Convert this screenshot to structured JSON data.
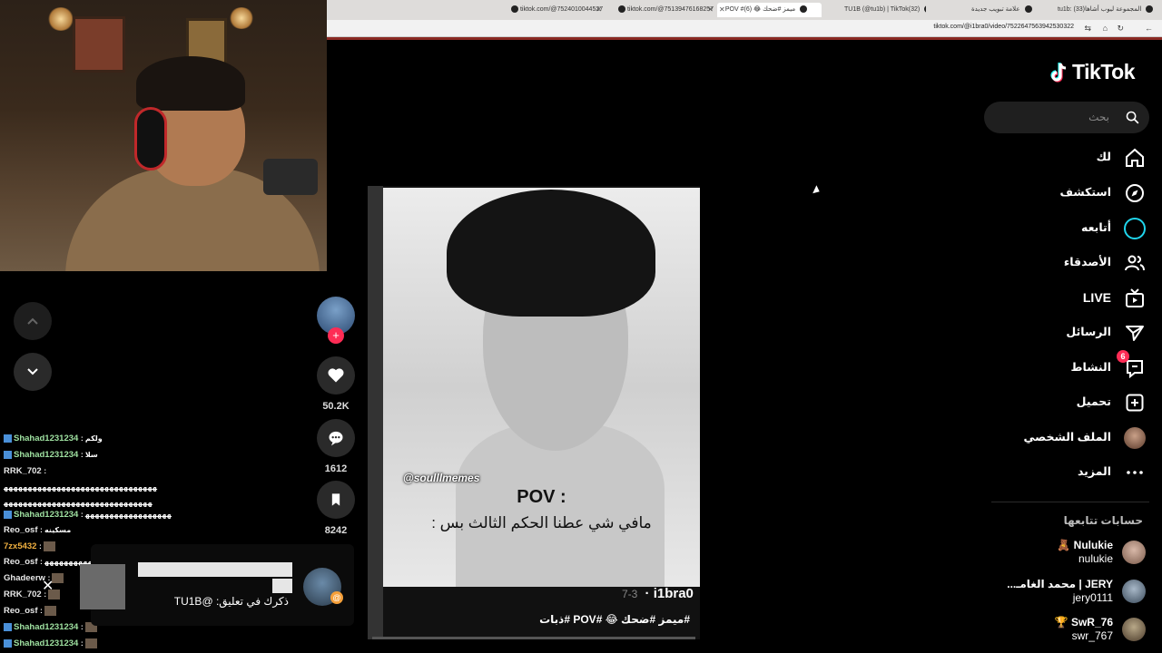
{
  "browser": {
    "tabs": [
      {
        "title": "tiktok.com/@7524010044527",
        "active": false
      },
      {
        "title": "tiktok.com/@75139476168257",
        "active": false
      },
      {
        "title": "POV #ميمز #ضحك 😂 (6)",
        "active": true
      },
      {
        "title": "TU1B (@tu1b) | TikTok(32)",
        "active": false
      },
      {
        "title": "علامة تبويب جديدة",
        "active": false
      },
      {
        "title": "tu1b: (33)المجموعة ليوب أشاها",
        "active": false
      }
    ],
    "url": "tiktok.com/@i1bra0/video/7522647563942530322"
  },
  "left": {
    "up_icon": "chevron-up-icon",
    "down_icon": "chevron-down-icon"
  },
  "chat": {
    "lines": [
      {
        "user": "Shahad1231234",
        "msg": ": ولكم",
        "color": "green"
      },
      {
        "user": "Shahad1231234",
        "msg": ": سلا",
        "color": "green"
      },
      {
        "user": "RRK_702",
        "msg": ":",
        "color": "white"
      },
      {
        "user": "",
        "msg": "ﻬﻬﻬﻬﻬﻬﻬﻬﻬﻬﻬﻬﻬﻬﻬﻬﻬﻬﻬﻬﻬﻬﻬﻬﻬﻬﻬﻬﻬﻬﻬﻬ",
        "color": "white"
      },
      {
        "user": "",
        "msg": "ﻬﻬﻬﻬﻬﻬﻬﻬﻬﻬﻬﻬﻬﻬﻬﻬﻬﻬﻬﻬﻬﻬﻬﻬﻬﻬﻬﻬﻬﻬﻬ",
        "color": "white"
      },
      {
        "user": "Shahad1231234",
        "msg": ": ﻬﻬﻬﻬﻬﻬﻬﻬﻬﻬﻬﻬﻬﻬﻬﻬﻬﻬ",
        "color": "green"
      },
      {
        "user": "Reo_osf",
        "msg": ": مسكينه",
        "color": "white"
      },
      {
        "user": "7zx5432",
        "msg": ":",
        "color": "orange"
      },
      {
        "user": "Reo_osf",
        "msg": ": ﻬﻬﻬﻬﻬﻬﻬﻬﻬﻬﻬﻬﻬﻬﻬﻬﻬﻬﻬ",
        "color": "white"
      },
      {
        "user": "Ghadeerw",
        "msg": ":",
        "color": "white"
      },
      {
        "user": "RRK_702",
        "msg": ":",
        "color": "white"
      },
      {
        "user": "Reo_osf",
        "msg": ":",
        "color": "white"
      },
      {
        "user": "Shahad1231234",
        "msg": ":",
        "color": "green"
      },
      {
        "user": "Shahad1231234",
        "msg": ":",
        "color": "green"
      }
    ]
  },
  "notification": {
    "text": "ذكرك في تعليق: @TU1B"
  },
  "actions": {
    "likes": "50.2K",
    "comments": "1612",
    "saves": "8242"
  },
  "video": {
    "watermark": "@soulllmemes",
    "pov": "POV :",
    "caption": "مافي شي عطنا الحكم الثالث بس :",
    "author": "i1bra0",
    "date": "7-3",
    "tags": "#ميمز #ضحك 😂 #POV #ذبات"
  },
  "sidebar": {
    "logo": "TikTok",
    "search_placeholder": "بحث",
    "nav": [
      {
        "label": "لك",
        "icon": "home-icon"
      },
      {
        "label": "استكشف",
        "icon": "compass-icon"
      },
      {
        "label": "أتابعه",
        "icon": "following-icon"
      },
      {
        "label": "الأصدقاء",
        "icon": "friends-icon"
      },
      {
        "label": "LIVE",
        "icon": "live-icon"
      },
      {
        "label": "الرسائل",
        "icon": "send-icon"
      },
      {
        "label": "النشاط",
        "icon": "activity-icon",
        "badge": "6"
      },
      {
        "label": "تحميل",
        "icon": "upload-icon"
      },
      {
        "label": "الملف الشخصي",
        "icon": "profile-avatar"
      },
      {
        "label": "المزيد",
        "icon": "more-icon"
      }
    ],
    "following_header": "حسابات تتابعها",
    "following": [
      {
        "name": "Nulukie 🧸",
        "handle": "nulukie"
      },
      {
        "name": "JERY | محمد الغامـ...",
        "handle": "jery0111"
      },
      {
        "name": "SwR_76 🏆",
        "handle": "swr_767"
      }
    ]
  },
  "colors": {
    "accent": "#fe2c55",
    "cyan": "#20d5ec",
    "background": "#000000"
  }
}
